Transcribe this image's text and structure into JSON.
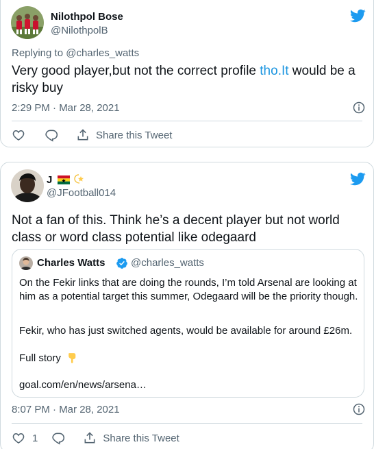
{
  "tweets": [
    {
      "name": "Nilothpol Bose",
      "handle": "@NilothpolB",
      "replying_to": "Replying to @charles_watts",
      "text_before_link": "Very good player,but not the correct profile ",
      "text_link": "tho.It",
      "text_after_link": " would be a risky buy",
      "timestamp": "2:29 PM · Mar 28, 2021",
      "like_count": "",
      "share_label": "Share this Tweet"
    },
    {
      "name": "J",
      "name_emojis": [
        "ghana-flag",
        "dizzy-star"
      ],
      "handle": "@JFootball014",
      "text": "Not a fan of this. Think he’s a decent player but not world class or word class potential like odegaard",
      "timestamp": "8:07 PM · Mar 28, 2021",
      "like_count": "1",
      "share_label": "Share this Tweet",
      "quoted": {
        "name": "Charles Watts",
        "handle": "@charles_watts",
        "verified": true,
        "paragraph1": "On the Fekir links that are doing the rounds, I’m told Arsenal are looking at him as a potential target this summer, Odegaard will be the priority though.",
        "paragraph2": "Fekir, who has just switched agents, would be available for around £26m.",
        "paragraph3": "Full story",
        "paragraph3_emoji": "backhand-index-pointing-down",
        "link": "goal.com/en/news/arsena…"
      }
    }
  ],
  "colors": {
    "twitter_blue": "#1d9bf0",
    "link_blue": "#1b95e0",
    "secondary_text": "#536471",
    "border": "#cfd9de",
    "arsenal_red": "#c8102e"
  },
  "icons": [
    "twitter-bird-icon",
    "info-icon",
    "heart-icon",
    "reply-icon",
    "share-icon",
    "verified-badge-icon"
  ]
}
